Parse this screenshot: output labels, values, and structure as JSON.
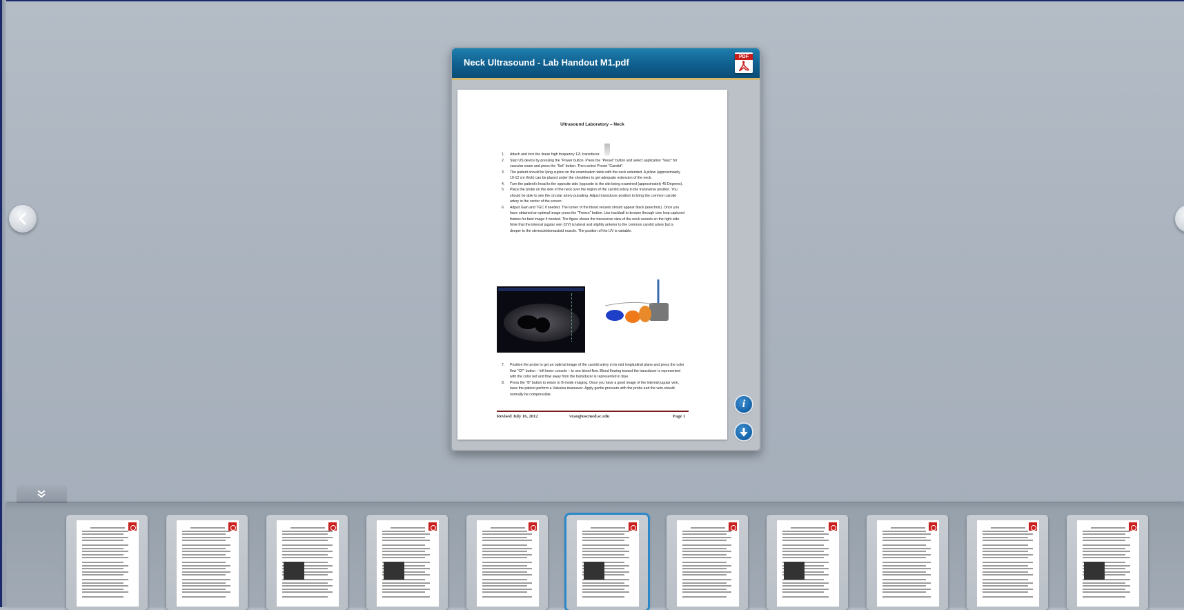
{
  "viewer": {
    "title": "Neck Ultrasound - Lab Handout  M1.pdf",
    "badge_label": "PDF",
    "icons": {
      "prev": "chevron-left-icon",
      "next": "chevron-right-icon",
      "info": "info-icon",
      "download": "download-icon",
      "collapse": "double-chevron-down-icon"
    }
  },
  "document": {
    "title": "Ultrasound Laboratory – Neck",
    "steps": [
      {
        "n": "1.",
        "text": "Attach and lock the linear high frequency 12L transducer."
      },
      {
        "n": "2.",
        "text": "Start US device by pressing the \"Power button. Press the \"Preset\" button and select application \"Vasc\" for vascular exam and press the \"Set\" button. Then select Preset \"Carotid\"."
      },
      {
        "n": "3.",
        "text": "The patient should be lying supine on the examination table with the neck extended. A pillow (approximately 10-12 cm thick) can be placed under the shoulders to get adequate extension of the neck."
      },
      {
        "n": "4.",
        "text": "Turn the patient's head to the opposite side (opposite to the site being examined (approximately 45 Degrees)."
      },
      {
        "n": "5.",
        "text": "Place the probe on the side of the neck over the region of the carotid artery in the transverse position. You should be able to see the circular artery pulsating. Adjust transducer position to bring the common carotid artery in the center of the screen."
      },
      {
        "n": "6.",
        "text": "Adjust Gain and TGC if needed. The lumen of the blood vessels should appear black (anechoic). Once you have obtained an optimal image press the \"Freeze\" button. Use trackball to browse through cine loop captured frames for best image if needed. The figure shows the transverse view of the neck vessels on the right side. Note that the internal jugular vein (IJV) is lateral and slightly anterior to the common carotid artery but is deeper to the sternocleidomastoid muscle. The position of the IJV is variable."
      }
    ],
    "steps2": [
      {
        "n": "7.",
        "text": "Position the probe to get an optimal image of the carotid artery in its mid longitudinal plane and press the color flow \"CF\" button – left lower console – to see blood flow. Blood flowing toward the transducer is represented with the color red and flow away from the transducer is represented in blue."
      },
      {
        "n": "8.",
        "text": "Press the \"B\" button to return to B-mode imaging. Once you have a good image of the internal jugular vein, have the patient perform a Valsalva maneuver. Apply gentle pressure with the probe and the vein should normally be compressible."
      }
    ],
    "footer": {
      "left": "Revised July 16, 2012",
      "center": "vrao@uscmed.sc.edu",
      "right": "Page 1"
    }
  },
  "thumbnails": [
    {
      "id": 1,
      "selected": false
    },
    {
      "id": 2,
      "selected": false
    },
    {
      "id": 3,
      "selected": false
    },
    {
      "id": 4,
      "selected": false
    },
    {
      "id": 5,
      "selected": false
    },
    {
      "id": 6,
      "selected": true
    },
    {
      "id": 7,
      "selected": false
    },
    {
      "id": 8,
      "selected": false
    },
    {
      "id": 9,
      "selected": false
    },
    {
      "id": 10,
      "selected": false
    },
    {
      "id": 11,
      "selected": false
    }
  ],
  "colors": {
    "accent": "#2a88c8",
    "header": "#0f5f8e",
    "pdf_red": "#c9201e"
  }
}
